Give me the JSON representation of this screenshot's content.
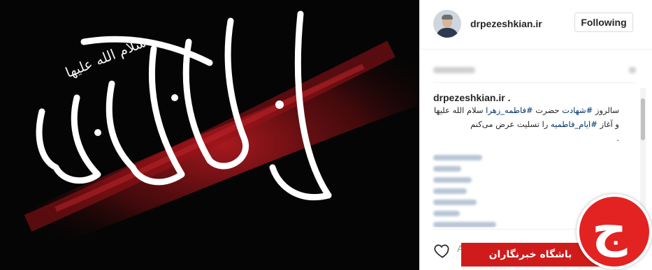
{
  "post": {
    "image_description_icon": "calligraphy-artwork",
    "calligraphy_main": "یا فاطمة الزهراء",
    "calligraphy_small": "سلام الله علیها"
  },
  "header": {
    "username": "drpezeshkian.ir",
    "follow_label": "Following"
  },
  "caption": {
    "username": "drpezeshkian.ir",
    "text_before_tag1": "سالروز ",
    "tag1": "#شهادت",
    "text_mid1": " حضرت ",
    "tag2": "#فاطمه_زهرا",
    "text_mid2": " سلام الله علیها و آغاز ",
    "tag3": "#ایام_فاطمیه",
    "text_end": " را تسلیت عرض می‌کنم",
    "dot": "."
  },
  "actions": {
    "like_icon": "heart-icon",
    "comment_placeholder_letter": "A"
  },
  "overlay": {
    "banner_text": "باشگاه خبرنگاران",
    "logo_glyph": "ج"
  },
  "colors": {
    "hashtag": "#003569",
    "banner_red": "#d01b1b",
    "photo_bg": "#050505",
    "brush_red": "#a3171c"
  }
}
